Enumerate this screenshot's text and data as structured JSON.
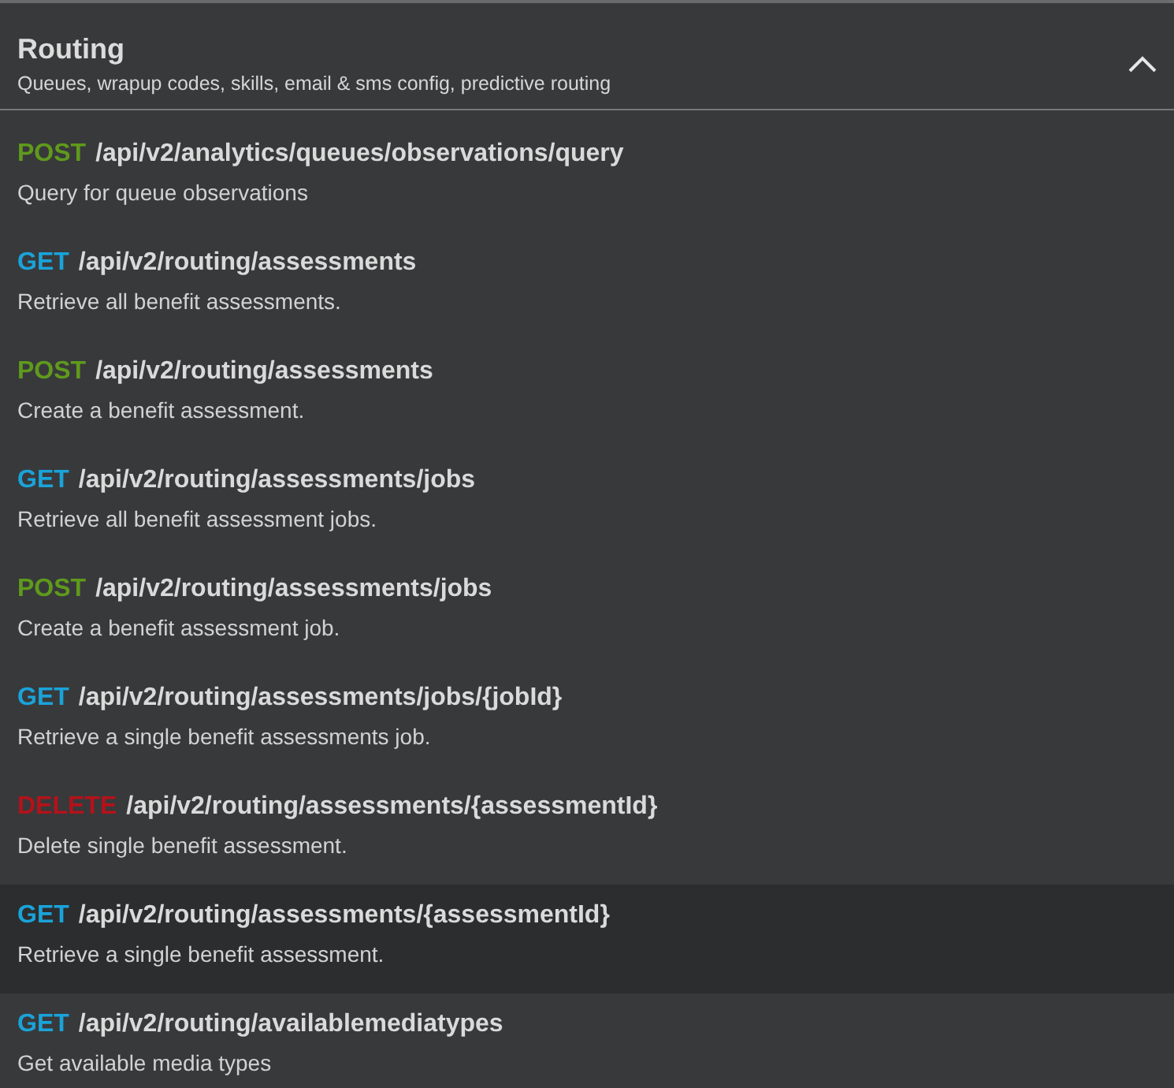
{
  "section": {
    "title": "Routing",
    "subtitle": "Queues, wrapup codes, skills, email & sms config, predictive routing",
    "expanded": true
  },
  "endpoints": [
    {
      "method": "POST",
      "path": "/api/v2/analytics/queues/observations/query",
      "description": "Query for queue observations",
      "highlighted": false
    },
    {
      "method": "GET",
      "path": "/api/v2/routing/assessments",
      "description": "Retrieve all benefit assessments.",
      "highlighted": false
    },
    {
      "method": "POST",
      "path": "/api/v2/routing/assessments",
      "description": "Create a benefit assessment.",
      "highlighted": false
    },
    {
      "method": "GET",
      "path": "/api/v2/routing/assessments/jobs",
      "description": "Retrieve all benefit assessment jobs.",
      "highlighted": false
    },
    {
      "method": "POST",
      "path": "/api/v2/routing/assessments/jobs",
      "description": "Create a benefit assessment job.",
      "highlighted": false
    },
    {
      "method": "GET",
      "path": "/api/v2/routing/assessments/jobs/{jobId}",
      "description": "Retrieve a single benefit assessments job.",
      "highlighted": false
    },
    {
      "method": "DELETE",
      "path": "/api/v2/routing/assessments/{assessmentId}",
      "description": "Delete single benefit assessment.",
      "highlighted": false
    },
    {
      "method": "GET",
      "path": "/api/v2/routing/assessments/{assessmentId}",
      "description": "Retrieve a single benefit assessment.",
      "highlighted": true
    },
    {
      "method": "GET",
      "path": "/api/v2/routing/availablemediatypes",
      "description": "Get available media types",
      "highlighted": false
    }
  ]
}
